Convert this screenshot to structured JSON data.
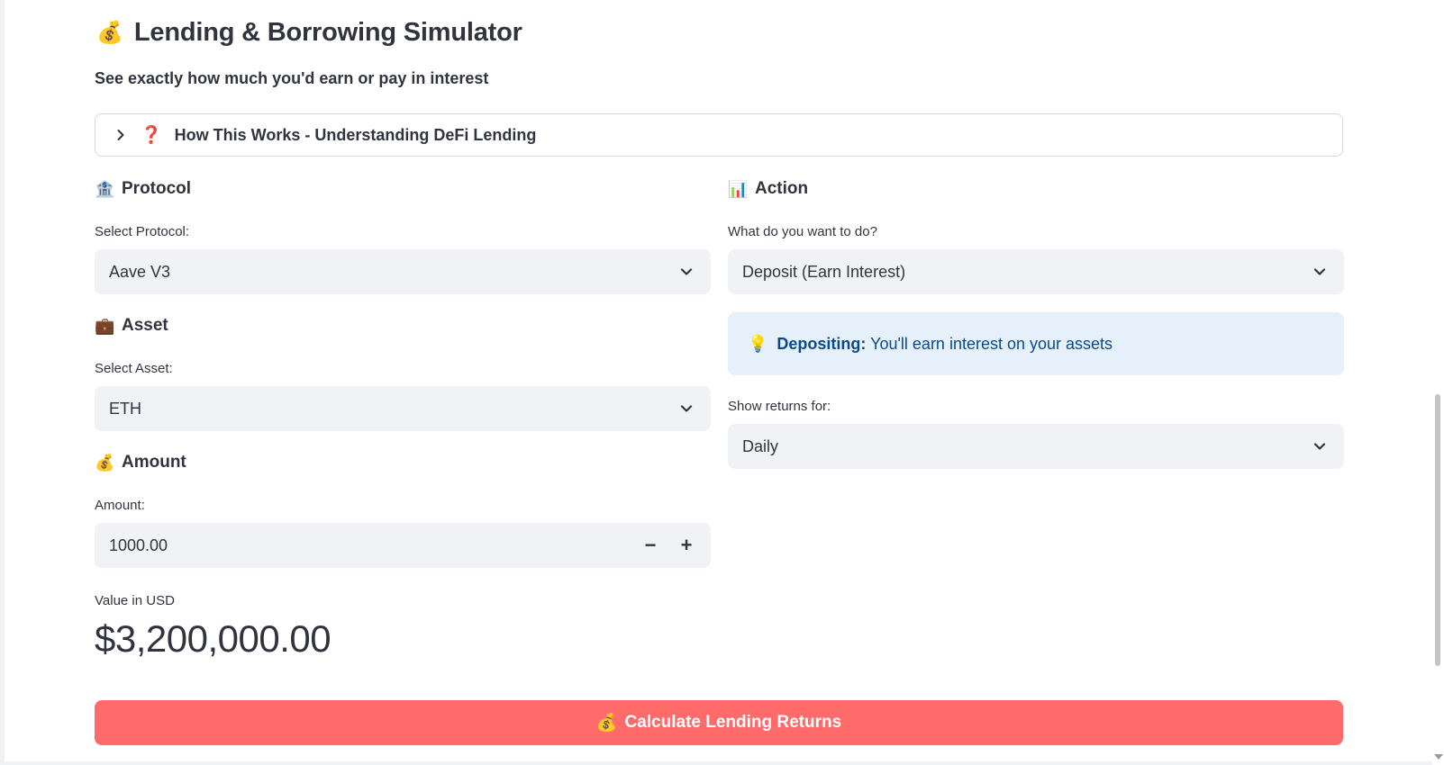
{
  "header": {
    "emoji": "💰",
    "title": "Lending & Borrowing Simulator",
    "subtitle": "See exactly how much you'd earn or pay in interest"
  },
  "expander": {
    "icon": "❓",
    "label": "How This Works - Understanding DeFi Lending"
  },
  "protocol": {
    "icon": "🏦",
    "heading": "Protocol",
    "label": "Select Protocol:",
    "value": "Aave V3"
  },
  "asset": {
    "icon": "💼",
    "heading": "Asset",
    "label": "Select Asset:",
    "value": "ETH"
  },
  "amount": {
    "icon": "💰",
    "heading": "Amount",
    "label": "Amount:",
    "value": "1000.00",
    "minus": "−",
    "plus": "+"
  },
  "usd": {
    "label": "Value in USD",
    "value": "$3,200,000.00"
  },
  "action": {
    "icon": "📊",
    "heading": "Action",
    "label": "What do you want to do?",
    "value": "Deposit (Earn Interest)"
  },
  "info": {
    "icon": "💡",
    "bold": "Depositing:",
    "text": "You'll earn interest on your assets"
  },
  "returns": {
    "label": "Show returns for:",
    "value": "Daily"
  },
  "button": {
    "icon": "💰",
    "label": "Calculate Lending Returns"
  },
  "colors": {
    "primary_button": "#ff6b6b",
    "info_bg": "#e5f0fb",
    "info_text": "#0b4a8a",
    "input_bg": "#f0f2f6"
  }
}
